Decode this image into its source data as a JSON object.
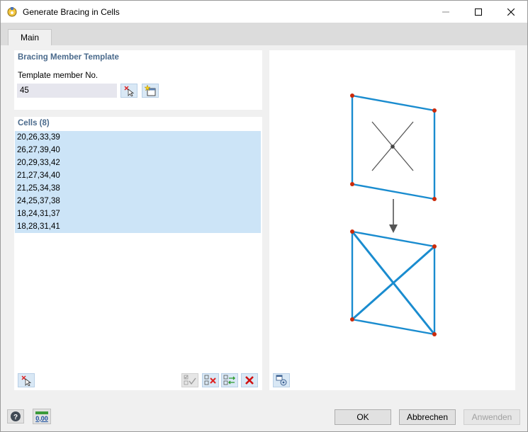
{
  "window": {
    "title": "Generate Bracing in Cells"
  },
  "tabs": [
    {
      "label": "Main"
    }
  ],
  "template": {
    "section_title": "Bracing Member Template",
    "member_label": "Template member No.",
    "member_value": "45"
  },
  "cells": {
    "section_title": "Cells (8)",
    "items": [
      "20,26,33,39",
      "26,27,39,40",
      "20,29,33,42",
      "21,27,34,40",
      "21,25,34,38",
      "24,25,37,38",
      "18,24,31,37",
      "18,28,31,41"
    ]
  },
  "footer": {
    "ok_label": "OK",
    "cancel_label": "Abbrechen",
    "apply_label": "Anwenden",
    "units_label": "0,00"
  },
  "colors": {
    "accent": "#1a8ccf",
    "node": "#cc2a0a",
    "selection": "#cce4f7"
  }
}
